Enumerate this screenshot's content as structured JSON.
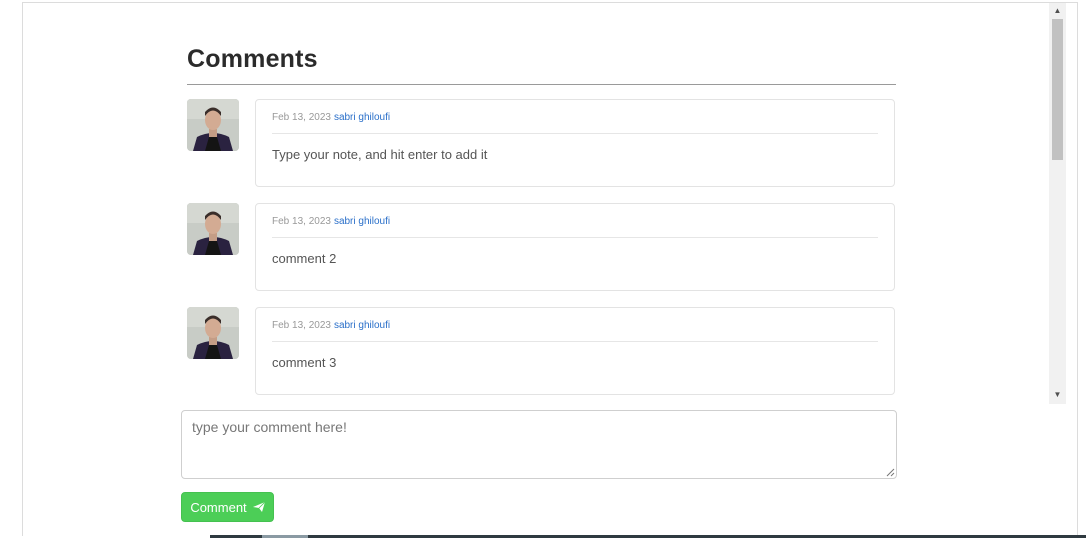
{
  "comments_section": {
    "title": "Comments",
    "comments": [
      {
        "date": "Feb 13, 2023",
        "author": "sabri ghiloufi",
        "text": "Type your note, and hit enter to add it",
        "avatar_icon": "user-photo-avatar"
      },
      {
        "date": "Feb 13, 2023",
        "author": "sabri ghiloufi",
        "text": "comment 2",
        "avatar_icon": "user-photo-avatar"
      },
      {
        "date": "Feb 13, 2023",
        "author": "sabri ghiloufi",
        "text": "comment 3",
        "avatar_icon": "user-photo-avatar"
      }
    ]
  },
  "composer": {
    "placeholder": "type your comment here!",
    "value": "",
    "submit_label": "Comment",
    "submit_icon": "send-icon"
  },
  "colors": {
    "accent_green": "#4cce57",
    "author_link": "#2a6fc9"
  }
}
